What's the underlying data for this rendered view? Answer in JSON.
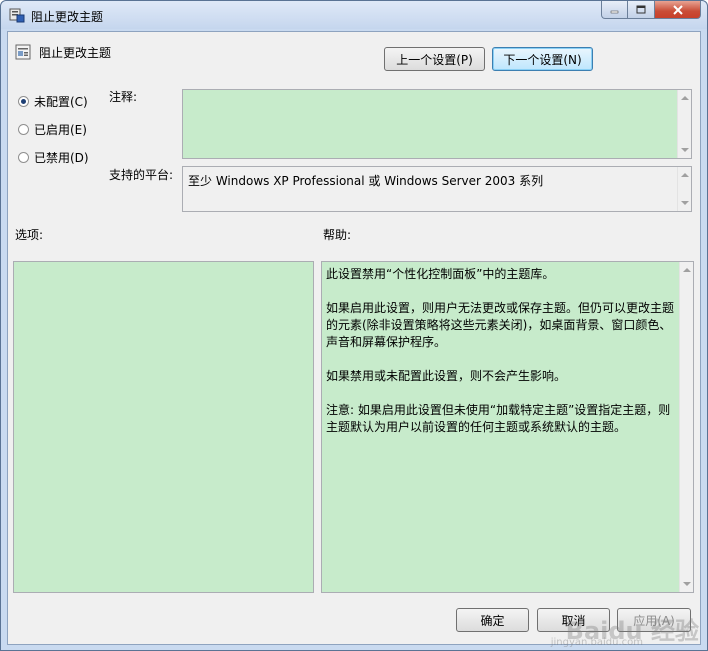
{
  "window": {
    "title": "阻止更改主题",
    "header_title": "阻止更改主题"
  },
  "nav": {
    "prev_label": "上一个设置(P)",
    "next_label": "下一个设置(N)"
  },
  "state": {
    "options": [
      {
        "label": "未配置(C)",
        "selected": true
      },
      {
        "label": "已启用(E)",
        "selected": false
      },
      {
        "label": "已禁用(D)",
        "selected": false
      }
    ]
  },
  "comment": {
    "label": "注释:",
    "value": ""
  },
  "platform": {
    "label": "支持的平台:",
    "value": "至少 Windows XP Professional 或 Windows Server 2003 系列"
  },
  "options_panel": {
    "label": "选项:"
  },
  "help": {
    "label": "帮助:",
    "paragraphs": [
      "此设置禁用“个性化控制面板”中的主题库。",
      "如果启用此设置，则用户无法更改或保存主题。但仍可以更改主题的元素(除非设置策略将这些元素关闭)，如桌面背景、窗口颜色、声音和屏幕保护程序。",
      "如果禁用或未配置此设置，则不会产生影响。",
      "注意: 如果启用此设置但未使用“加载特定主题”设置指定主题，则主题默认为用户以前设置的任何主题或系统默认的主题。"
    ]
  },
  "footer": {
    "ok_label": "确定",
    "cancel_label": "取消",
    "apply_label": "应用(A)"
  },
  "watermark": {
    "main": "Baidu 经验",
    "sub": "jingyan.baidu.com"
  },
  "colors": {
    "green_field": "#c7ebcb",
    "client_bg": "#f0f0f0"
  }
}
